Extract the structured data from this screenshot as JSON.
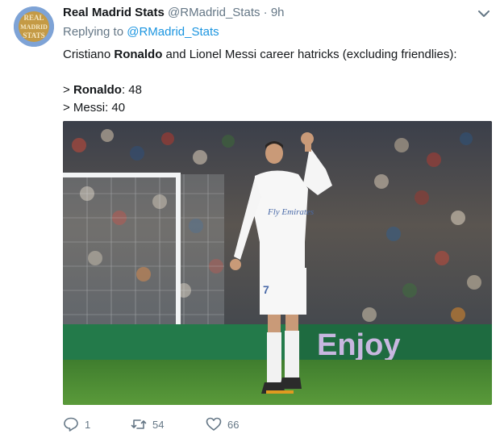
{
  "tweet": {
    "display_name": "Real Madrid Stats",
    "handle": "@RMadrid_Stats",
    "separator": "·",
    "time": "9h",
    "replying_prefix": "Replying to",
    "replying_handle": "@RMadrid_Stats",
    "line1_pre": "Cristiano ",
    "line1_bold": "Ronaldo",
    "line1_post": " and Lionel Messi career hatricks (excluding friendlies):",
    "line2_prefix": "> ",
    "line2_bold": "Ronaldo",
    "line2_post": ": 48",
    "line3": "> Messi: 40",
    "avatar_text": [
      "REAL",
      "MADRID",
      "STATS"
    ]
  },
  "media": {
    "jersey_number": "7",
    "jersey_sponsor": "Fly Emirates",
    "board_text": "Enjoy",
    "icons": [
      "player-photo"
    ]
  },
  "actions": {
    "reply_count": "1",
    "retweet_count": "54",
    "like_count": "66"
  },
  "colors": {
    "link": "#1b95e0",
    "secondary_text": "#657786",
    "primary_text": "#14171a"
  }
}
